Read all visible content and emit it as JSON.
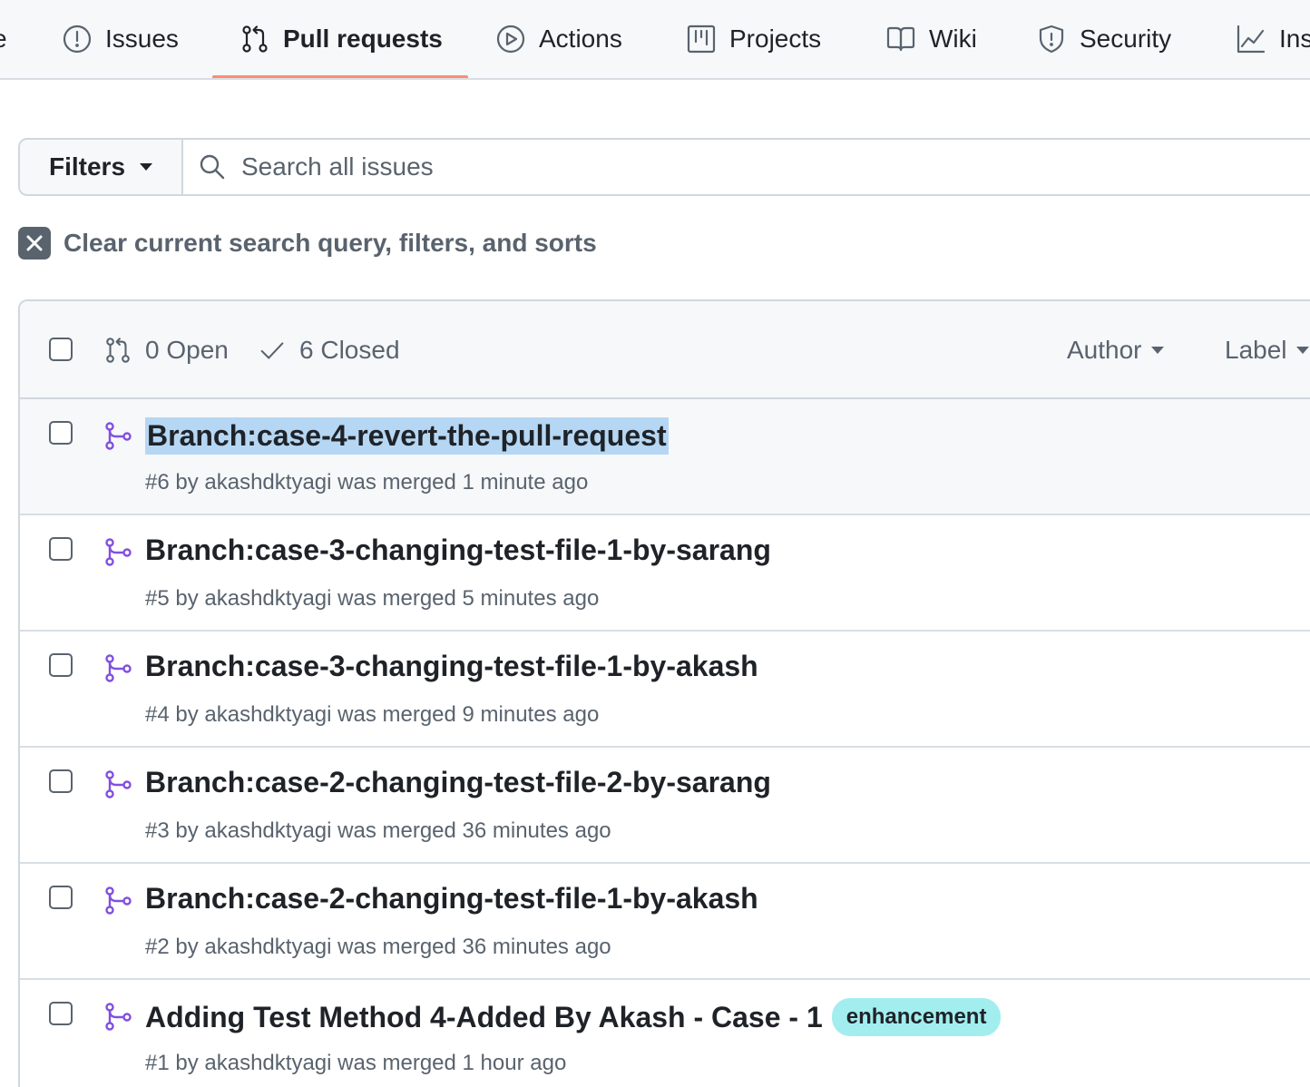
{
  "nav": {
    "tabs": [
      {
        "label": "e",
        "icon": "none"
      },
      {
        "label": "Issues",
        "icon": "issue-icon"
      },
      {
        "label": "Pull requests",
        "icon": "pull-request-icon",
        "active": true
      },
      {
        "label": "Actions",
        "icon": "play-icon"
      },
      {
        "label": "Projects",
        "icon": "table-icon"
      },
      {
        "label": "Wiki",
        "icon": "book-icon"
      },
      {
        "label": "Security",
        "icon": "shield-icon"
      },
      {
        "label": "Ins",
        "icon": "graph-icon"
      }
    ]
  },
  "filters": {
    "button_label": "Filters",
    "search_placeholder": "Search all issues",
    "search_value": ""
  },
  "clear": {
    "label": "Clear current search query, filters, and sorts"
  },
  "list_header": {
    "open_label": "0 Open",
    "closed_label": "6 Closed",
    "author_label": "Author",
    "label_label": "Label"
  },
  "pull_requests": [
    {
      "title": "Branch:case-4-revert-the-pull-request",
      "meta": "#6 by akashdktyagi was merged 1 minute ago",
      "label": "",
      "selected": true
    },
    {
      "title": "Branch:case-3-changing-test-file-1-by-sarang",
      "meta": "#5 by akashdktyagi was merged 5 minutes ago",
      "label": ""
    },
    {
      "title": "Branch:case-3-changing-test-file-1-by-akash",
      "meta": "#4 by akashdktyagi was merged 9 minutes ago",
      "label": ""
    },
    {
      "title": "Branch:case-2-changing-test-file-2-by-sarang",
      "meta": "#3 by akashdktyagi was merged 36 minutes ago",
      "label": ""
    },
    {
      "title": "Branch:case-2-changing-test-file-1-by-akash",
      "meta": "#2 by akashdktyagi was merged 36 minutes ago",
      "label": ""
    },
    {
      "title": "Adding Test Method 4-Added By Akash - Case - 1",
      "meta": "#1 by akashdktyagi was merged 1 hour ago",
      "label": "enhancement"
    }
  ],
  "colors": {
    "active_tab_underline": "#fd8c73",
    "merged_icon": "#8250df",
    "label_enhancement": "#a2eeef",
    "selection_highlight": "#b6d7f4"
  }
}
